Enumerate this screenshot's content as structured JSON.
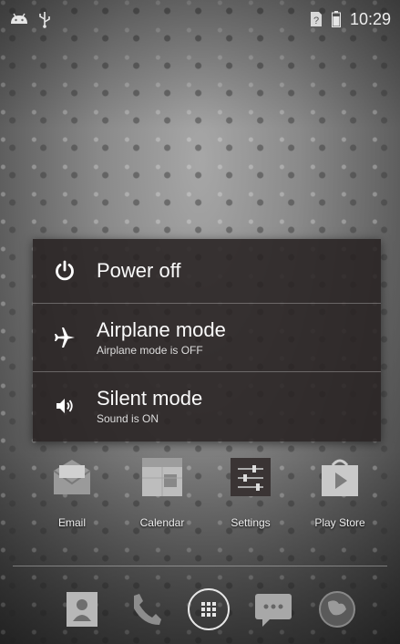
{
  "status_bar": {
    "time": "10:29",
    "icons_left": [
      "android-debug-icon",
      "usb-icon"
    ],
    "icons_right": [
      "no-sim-icon",
      "battery-icon"
    ]
  },
  "power_menu": {
    "items": [
      {
        "title": "Power off",
        "subtitle": "",
        "icon": "power-icon"
      },
      {
        "title": "Airplane mode",
        "subtitle": "Airplane mode is OFF",
        "icon": "airplane-icon"
      },
      {
        "title": "Silent mode",
        "subtitle": "Sound is ON",
        "icon": "speaker-icon"
      }
    ]
  },
  "apps": [
    {
      "label": "Email",
      "icon": "email-app-icon"
    },
    {
      "label": "Calendar",
      "icon": "calendar-app-icon"
    },
    {
      "label": "Settings",
      "icon": "settings-app-icon"
    },
    {
      "label": "Play Store",
      "icon": "play-store-app-icon"
    }
  ],
  "dock": [
    "contacts-icon",
    "phone-icon",
    "all-apps-icon",
    "messaging-icon",
    "browser-icon"
  ],
  "colors": {
    "dialog_bg": "#2a2222",
    "text": "#ffffff"
  }
}
